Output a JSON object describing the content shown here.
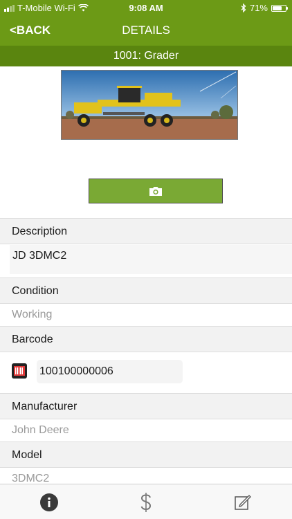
{
  "status_bar": {
    "carrier": "T-Mobile Wi-Fi",
    "time": "9:08 AM",
    "battery_text": "71%",
    "battery_level": 0.71,
    "icons": [
      "signal-icon",
      "wifi-icon",
      "bluetooth-icon",
      "battery-icon"
    ]
  },
  "nav": {
    "back_label": "<BACK",
    "title": "DETAILS"
  },
  "asset": {
    "header": "1001: Grader"
  },
  "fields": {
    "description": {
      "label": "Description",
      "value": "JD 3DMC2"
    },
    "condition": {
      "label": "Condition",
      "value": "Working"
    },
    "barcode": {
      "label": "Barcode",
      "value": "100100000006"
    },
    "manufacturer": {
      "label": "Manufacturer",
      "value": "John Deere"
    },
    "model": {
      "label": "Model",
      "value": "3DMC2"
    }
  },
  "tabs": [
    {
      "icon": "info-icon"
    },
    {
      "icon": "dollar-icon"
    },
    {
      "icon": "edit-icon"
    }
  ],
  "colors": {
    "brand_green": "#6c9a16",
    "sub_header_green": "#5a850f",
    "button_green": "#7aa934"
  }
}
